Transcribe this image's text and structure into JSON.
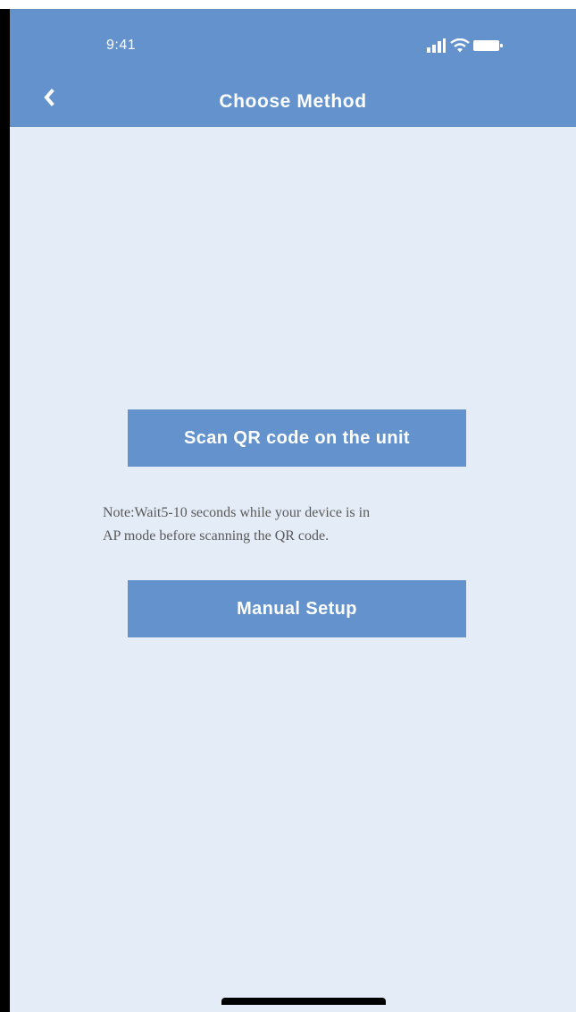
{
  "status_bar": {
    "time": "9:41"
  },
  "header": {
    "title": "Choose Method",
    "back_icon": "chevron-left-icon"
  },
  "main": {
    "scan_button_label": "Scan QR code on the unit",
    "note_line1": "Note:Wait5-10 seconds while your device is in",
    "note_line2": "AP mode before scanning the QR code.",
    "manual_button_label": "Manual Setup"
  },
  "colors": {
    "header_bg": "#6392cc",
    "button_bg": "#6392cc",
    "screen_bg": "#e4ecf7",
    "note_text": "#5a5a5a"
  }
}
